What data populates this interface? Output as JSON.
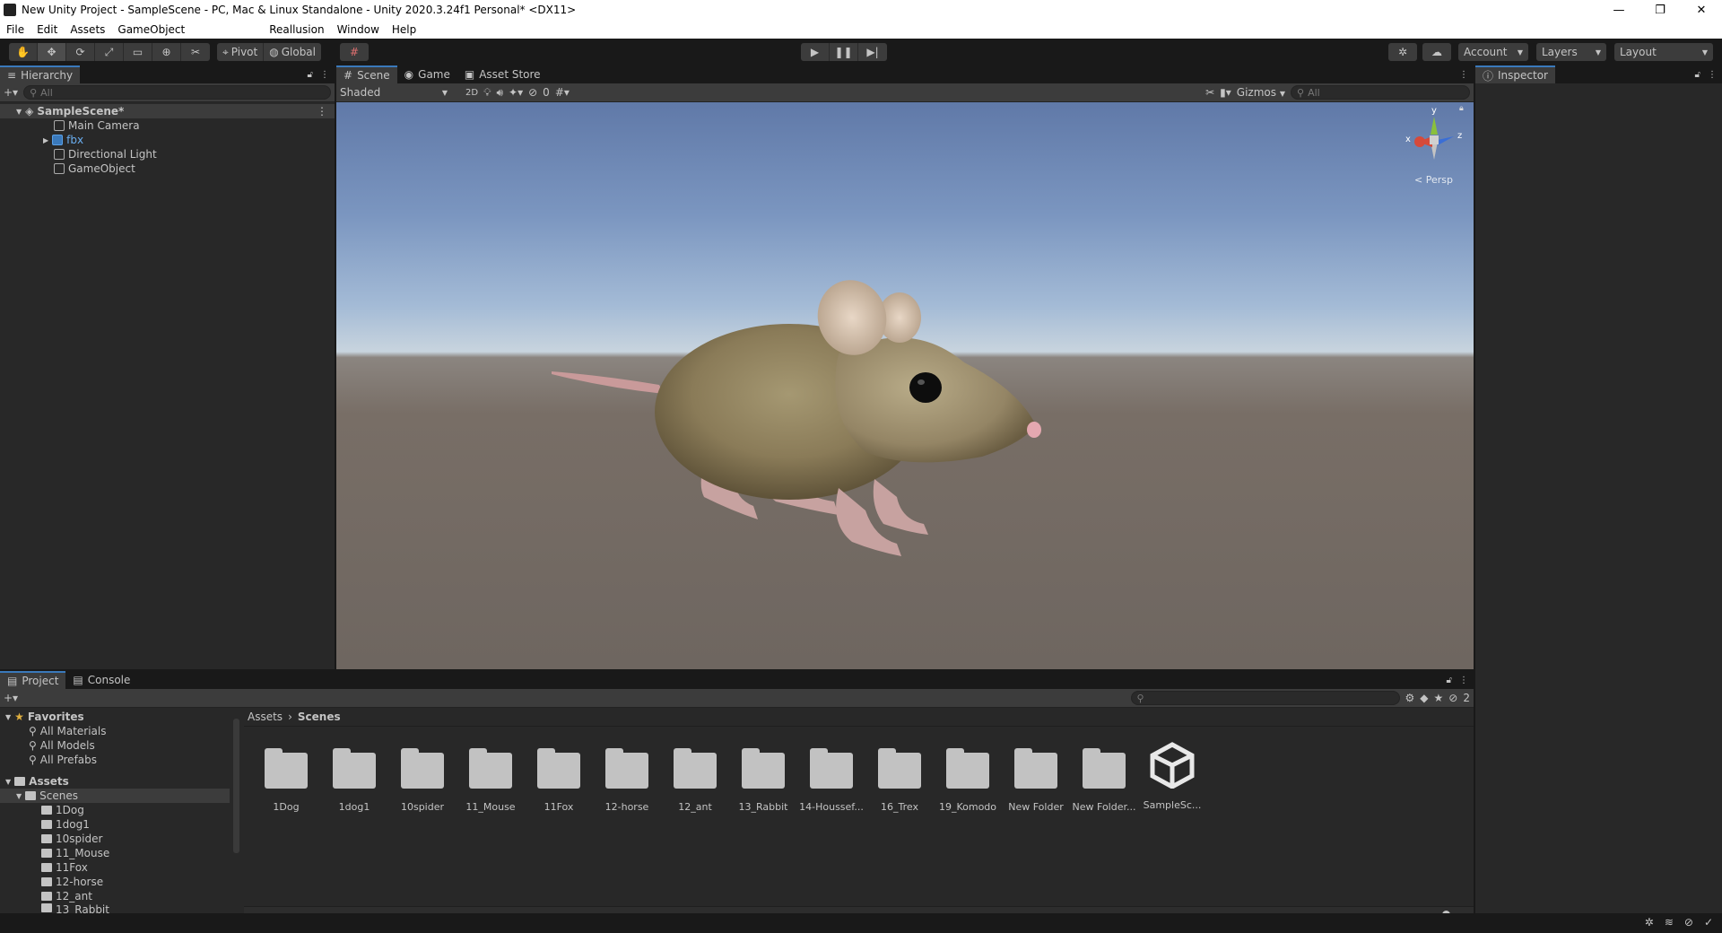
{
  "window": {
    "title": "New Unity Project - SampleScene - PC, Mac & Linux Standalone - Unity 2020.3.24f1 Personal* <DX11>",
    "minimize": "—",
    "maximize": "❐",
    "close": "✕"
  },
  "menu": [
    "File",
    "Edit",
    "Assets",
    "GameObject",
    "Reallusion",
    "Window",
    "Help"
  ],
  "toolbar": {
    "pivot": "Pivot",
    "global": "Global",
    "account": "Account",
    "layers": "Layers",
    "layout": "Layout"
  },
  "hierarchy": {
    "tab": "Hierarchy",
    "search_placeholder": "All",
    "scene": "SampleScene*",
    "items": [
      "Main Camera",
      "fbx",
      "Directional Light",
      "GameObject"
    ]
  },
  "scene_view": {
    "tabs": [
      "Scene",
      "Game",
      "Asset Store"
    ],
    "shading": "Shaded",
    "mode_2d": "2D",
    "hidden_count": "0",
    "gizmos": "Gizmos",
    "search_placeholder": "All",
    "axis_y": "y",
    "axis_x": "x",
    "axis_z": "z",
    "projection": "< Persp"
  },
  "inspector": {
    "tab": "Inspector"
  },
  "project": {
    "tabs": [
      "Project",
      "Console"
    ],
    "favorites_label": "Favorites",
    "favorites": [
      "All Materials",
      "All Models",
      "All Prefabs"
    ],
    "assets_label": "Assets",
    "scenes_label": "Scenes",
    "tree": [
      "1Dog",
      "1dog1",
      "10spider",
      "11_Mouse",
      "11Fox",
      "12-horse",
      "12_ant",
      "13_Rabbit"
    ],
    "breadcrumb": [
      "Assets",
      "Scenes"
    ],
    "hidden_count": "2",
    "assets": [
      "1Dog",
      "1dog1",
      "10spider",
      "11_Mouse",
      "11Fox",
      "12-horse",
      "12_ant",
      "13_Rabbit",
      "14-Houssef...",
      "16_Trex",
      "19_Komodo",
      "New Folder",
      "New Folder...",
      "SampleSc..."
    ]
  },
  "colors": {
    "accent": "#3a79bb",
    "panel": "#282828",
    "toolbar": "#191919"
  }
}
